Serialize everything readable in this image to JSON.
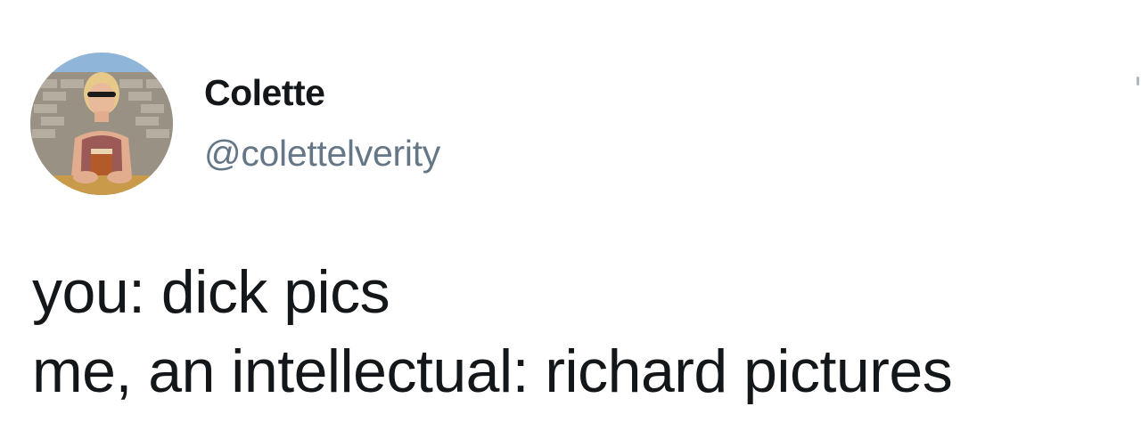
{
  "user": {
    "display_name": "Colette",
    "handle": "@colettelverity",
    "avatar_icon": "profile-photo-icon"
  },
  "tweet": {
    "lines": [
      "you: dick pics",
      "me, an intellectual: richard pictures"
    ]
  },
  "colors": {
    "text_primary": "#14171a",
    "text_secondary": "#657786",
    "background": "#ffffff"
  }
}
